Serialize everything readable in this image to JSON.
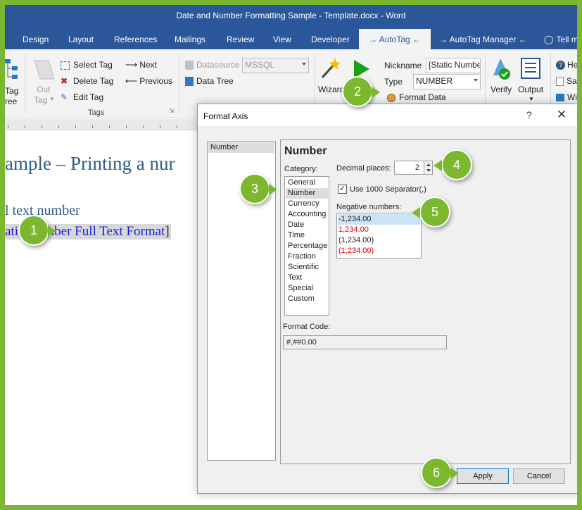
{
  "window": {
    "title": "Date and Number Formatting Sample - Template.docx  -  Word"
  },
  "ribbon_tabs": [
    "Design",
    "Layout",
    "References",
    "Mailings",
    "Review",
    "View",
    "Developer",
    "→ AutoTag ←",
    "→ AutoTag Manager ←",
    "Tell m"
  ],
  "ribbon": {
    "tag_tree_label_1": "Tag",
    "tag_tree_label_2": "ree",
    "out_tag_label_1": "Out",
    "out_tag_label_2": "Tag",
    "select_tag": "Select Tag",
    "delete_tag": "Delete Tag",
    "edit_tag": "Edit Tag",
    "next": "Next",
    "previous": "Previous",
    "tags_group": "Tags",
    "datasource_label": "Datasource",
    "datasource_value": "MSSQL",
    "data_tree": "Data Tree",
    "wizard": "Wizard",
    "nickname_label": "Nickname",
    "nickname_value": "[Static Numbe",
    "type_label": "Type",
    "type_value": "NUMBER",
    "format_data": "Format Data",
    "verify": "Verify",
    "output": "Output",
    "help_partial": "He",
    "sa_partial": "Sa",
    "wi_partial": "Wi"
  },
  "document": {
    "heading": "ample – Printing a nur",
    "subheading": "l text number",
    "field_text": "atic Number Full Text Format",
    "field_bracket": "]"
  },
  "dialog": {
    "title": "Format Axis",
    "help": "?",
    "close": "✕",
    "nav_items": [
      "Number"
    ],
    "panel_title": "Number",
    "category_label": "Category:",
    "categories": [
      "General",
      "Number",
      "Currency",
      "Accounting",
      "Date",
      "Time",
      "Percentage",
      "Fraction",
      "Scientific",
      "Text",
      "Special",
      "Custom"
    ],
    "selected_category": "Number",
    "decimal_places_label": "Decimal places:",
    "decimal_places": "2",
    "separator_label": "Use 1000 Separator(,)",
    "separator_checked": true,
    "negative_label": "Negative numbers:",
    "negative_options": [
      "-1,234.00",
      "1,234.00",
      "(1,234.00)",
      "(1,234.00)"
    ],
    "format_code_label": "Format Code:",
    "format_code": "#,##0.00",
    "apply": "Apply",
    "cancel": "Cancel"
  },
  "callouts": [
    "1",
    "2",
    "3",
    "4",
    "5",
    "6"
  ],
  "colors": {
    "accent": "#2b579a",
    "callout": "#7cb82f",
    "negative_red": "#e00000",
    "link_blue": "#1a1adb"
  }
}
